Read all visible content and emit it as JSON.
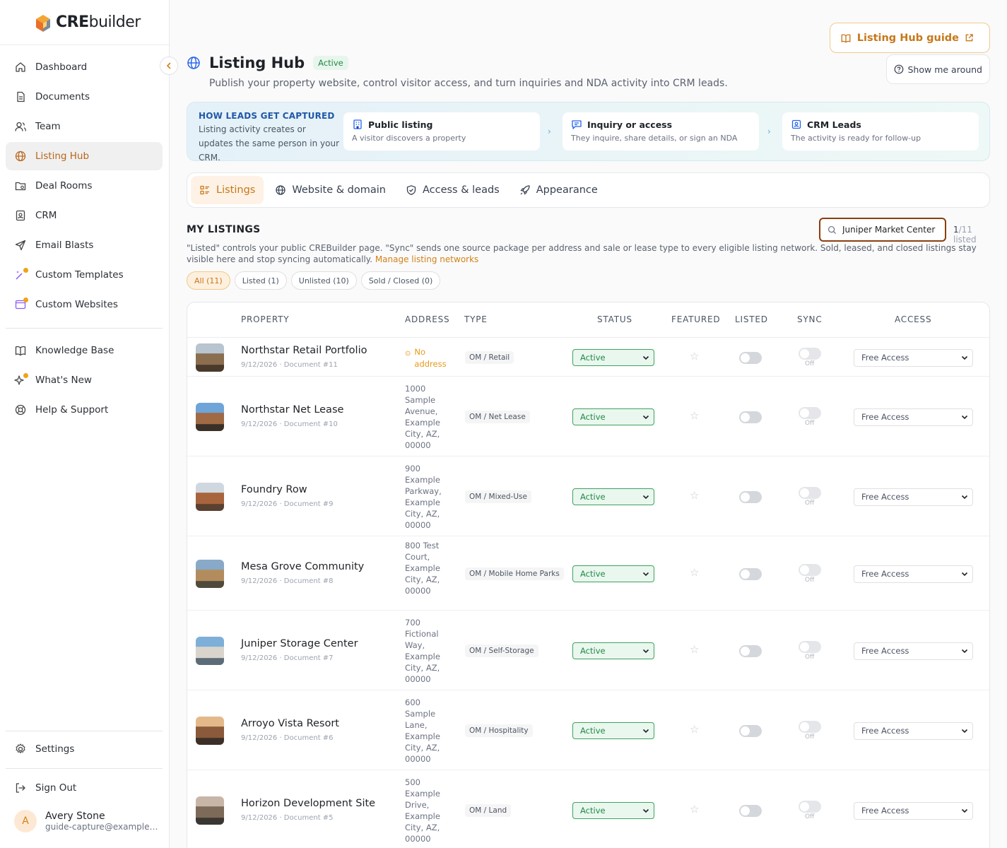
{
  "brand": {
    "name_bold": "CRE",
    "name_light": "builder"
  },
  "sidebar": {
    "items": [
      {
        "label": "Dashboard",
        "icon": "home-icon"
      },
      {
        "label": "Documents",
        "icon": "document-icon"
      },
      {
        "label": "Team",
        "icon": "team-icon"
      },
      {
        "label": "Listing Hub",
        "icon": "globe-icon",
        "active": true
      },
      {
        "label": "Deal Rooms",
        "icon": "folder-icon"
      },
      {
        "label": "CRM",
        "icon": "contact-icon"
      },
      {
        "label": "Email Blasts",
        "icon": "send-icon"
      },
      {
        "label": "Custom Templates",
        "icon": "magic-wand-icon"
      },
      {
        "label": "Custom Websites",
        "icon": "browser-icon"
      }
    ],
    "secondary": [
      {
        "label": "Knowledge Base",
        "icon": "book-icon"
      },
      {
        "label": "What's New",
        "icon": "sparkle-icon"
      },
      {
        "label": "Help & Support",
        "icon": "lifebuoy-icon"
      }
    ],
    "settings": "Settings",
    "sign_out": "Sign Out",
    "user": {
      "initial": "A",
      "name": "Avery Stone",
      "email": "guide-capture@example.com"
    }
  },
  "header": {
    "title": "Listing Hub",
    "badge": "Active",
    "subtitle": "Publish your property website, control visitor access, and turn inquiries and NDA activity into CRM leads.",
    "guide_button": "Listing Hub guide",
    "tour_button": "Show me around"
  },
  "flow": {
    "heading": "HOW LEADS GET CAPTURED",
    "text": "Listing activity creates or updates the same person in your CRM.",
    "steps": [
      {
        "title": "Public listing",
        "desc": "A visitor discovers a property"
      },
      {
        "title": "Inquiry or access",
        "desc": "They inquire, share details, or sign an NDA"
      },
      {
        "title": "CRM Leads",
        "desc": "The activity is ready for follow-up"
      }
    ]
  },
  "tabs": [
    "Listings",
    "Website & domain",
    "Access & leads",
    "Appearance"
  ],
  "listings": {
    "title": "MY LISTINGS",
    "search_value": "Juniper Market Center",
    "count_current": "1",
    "count_rest": "/11 listed",
    "description": "\"Listed\" controls your public CREBuilder page. \"Sync\" sends one source package per address and sale or lease type to every eligible listing network. Sold, leased, and closed listings stay visible here and stop syncing automatically.",
    "manage_link": "Manage listing networks",
    "filters": [
      "All (11)",
      "Listed (1)",
      "Unlisted (10)",
      "Sold / Closed (0)"
    ],
    "columns": [
      "PROPERTY",
      "ADDRESS",
      "TYPE",
      "STATUS",
      "FEATURED",
      "LISTED",
      "SYNC",
      "ACCESS"
    ],
    "no_address": "No address",
    "sync_off": "Off",
    "rows": [
      {
        "name": "Northstar Retail Portfolio",
        "meta": "9/12/2026 · Document #11",
        "address": "",
        "type": "OM / Retail",
        "status": "Active",
        "access": "Free Access"
      },
      {
        "name": "Northstar Net Lease",
        "meta": "9/12/2026 · Document #10",
        "address": "1000 Sample Avenue, Example City, AZ, 00000",
        "type": "OM / Net Lease",
        "status": "Active",
        "access": "Free Access"
      },
      {
        "name": "Foundry Row",
        "meta": "9/12/2026 · Document #9",
        "address": "900 Example Parkway, Example City, AZ, 00000",
        "type": "OM / Mixed-Use",
        "status": "Active",
        "access": "Free Access"
      },
      {
        "name": "Mesa Grove Community",
        "meta": "9/12/2026 · Document #8",
        "address": "800 Test Court, Example City, AZ, 00000",
        "type": "OM / Mobile Home Parks",
        "status": "Active",
        "access": "Free Access"
      },
      {
        "name": "Juniper Storage Center",
        "meta": "9/12/2026 · Document #7",
        "address": "700 Fictional Way, Example City, AZ, 00000",
        "type": "OM / Self-Storage",
        "status": "Active",
        "access": "Free Access"
      },
      {
        "name": "Arroyo Vista Resort",
        "meta": "9/12/2026 · Document #6",
        "address": "600 Sample Lane, Example City, AZ, 00000",
        "type": "OM / Hospitality",
        "status": "Active",
        "access": "Free Access"
      },
      {
        "name": "Horizon Development Site",
        "meta": "9/12/2026 · Document #5",
        "address": "500 Example Drive, Example City, AZ, 00000",
        "type": "OM / Land",
        "status": "Active",
        "access": "Free Access"
      }
    ]
  },
  "colors": {
    "accent": "#c8771a",
    "active_green": "#1f8a47",
    "flow_blue": "#2258a8"
  }
}
